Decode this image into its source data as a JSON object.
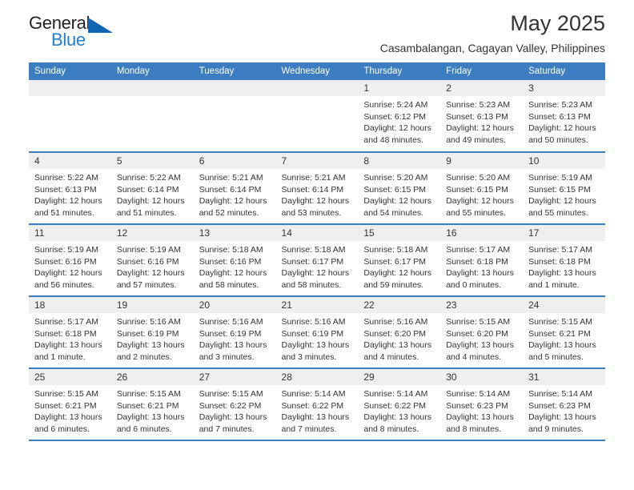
{
  "logo": {
    "word_top": "General",
    "word_bottom": "Blue",
    "triangle_icon": "triangle-icon",
    "color_black": "#231f20",
    "color_blue": "#1f7fd4"
  },
  "header": {
    "month_title": "May 2025",
    "location": "Casambalangan, Cagayan Valley, Philippines"
  },
  "theme": {
    "header_blue": "#3b7dc0",
    "daynum_gray": "#efefef",
    "text": "#333333"
  },
  "weekday_headers": [
    "Sunday",
    "Monday",
    "Tuesday",
    "Wednesday",
    "Thursday",
    "Friday",
    "Saturday"
  ],
  "weeks": [
    [
      {
        "day": "",
        "blank": true,
        "sunrise": "",
        "sunset": "",
        "daylight_line1": "",
        "daylight_line2": ""
      },
      {
        "day": "",
        "blank": true,
        "sunrise": "",
        "sunset": "",
        "daylight_line1": "",
        "daylight_line2": ""
      },
      {
        "day": "",
        "blank": true,
        "sunrise": "",
        "sunset": "",
        "daylight_line1": "",
        "daylight_line2": ""
      },
      {
        "day": "",
        "blank": true,
        "sunrise": "",
        "sunset": "",
        "daylight_line1": "",
        "daylight_line2": ""
      },
      {
        "day": "1",
        "blank": false,
        "sunrise": "Sunrise: 5:24 AM",
        "sunset": "Sunset: 6:12 PM",
        "daylight_line1": "Daylight: 12 hours",
        "daylight_line2": "and 48 minutes."
      },
      {
        "day": "2",
        "blank": false,
        "sunrise": "Sunrise: 5:23 AM",
        "sunset": "Sunset: 6:13 PM",
        "daylight_line1": "Daylight: 12 hours",
        "daylight_line2": "and 49 minutes."
      },
      {
        "day": "3",
        "blank": false,
        "sunrise": "Sunrise: 5:23 AM",
        "sunset": "Sunset: 6:13 PM",
        "daylight_line1": "Daylight: 12 hours",
        "daylight_line2": "and 50 minutes."
      }
    ],
    [
      {
        "day": "4",
        "blank": false,
        "sunrise": "Sunrise: 5:22 AM",
        "sunset": "Sunset: 6:13 PM",
        "daylight_line1": "Daylight: 12 hours",
        "daylight_line2": "and 51 minutes."
      },
      {
        "day": "5",
        "blank": false,
        "sunrise": "Sunrise: 5:22 AM",
        "sunset": "Sunset: 6:14 PM",
        "daylight_line1": "Daylight: 12 hours",
        "daylight_line2": "and 51 minutes."
      },
      {
        "day": "6",
        "blank": false,
        "sunrise": "Sunrise: 5:21 AM",
        "sunset": "Sunset: 6:14 PM",
        "daylight_line1": "Daylight: 12 hours",
        "daylight_line2": "and 52 minutes."
      },
      {
        "day": "7",
        "blank": false,
        "sunrise": "Sunrise: 5:21 AM",
        "sunset": "Sunset: 6:14 PM",
        "daylight_line1": "Daylight: 12 hours",
        "daylight_line2": "and 53 minutes."
      },
      {
        "day": "8",
        "blank": false,
        "sunrise": "Sunrise: 5:20 AM",
        "sunset": "Sunset: 6:15 PM",
        "daylight_line1": "Daylight: 12 hours",
        "daylight_line2": "and 54 minutes."
      },
      {
        "day": "9",
        "blank": false,
        "sunrise": "Sunrise: 5:20 AM",
        "sunset": "Sunset: 6:15 PM",
        "daylight_line1": "Daylight: 12 hours",
        "daylight_line2": "and 55 minutes."
      },
      {
        "day": "10",
        "blank": false,
        "sunrise": "Sunrise: 5:19 AM",
        "sunset": "Sunset: 6:15 PM",
        "daylight_line1": "Daylight: 12 hours",
        "daylight_line2": "and 55 minutes."
      }
    ],
    [
      {
        "day": "11",
        "blank": false,
        "sunrise": "Sunrise: 5:19 AM",
        "sunset": "Sunset: 6:16 PM",
        "daylight_line1": "Daylight: 12 hours",
        "daylight_line2": "and 56 minutes."
      },
      {
        "day": "12",
        "blank": false,
        "sunrise": "Sunrise: 5:19 AM",
        "sunset": "Sunset: 6:16 PM",
        "daylight_line1": "Daylight: 12 hours",
        "daylight_line2": "and 57 minutes."
      },
      {
        "day": "13",
        "blank": false,
        "sunrise": "Sunrise: 5:18 AM",
        "sunset": "Sunset: 6:16 PM",
        "daylight_line1": "Daylight: 12 hours",
        "daylight_line2": "and 58 minutes."
      },
      {
        "day": "14",
        "blank": false,
        "sunrise": "Sunrise: 5:18 AM",
        "sunset": "Sunset: 6:17 PM",
        "daylight_line1": "Daylight: 12 hours",
        "daylight_line2": "and 58 minutes."
      },
      {
        "day": "15",
        "blank": false,
        "sunrise": "Sunrise: 5:18 AM",
        "sunset": "Sunset: 6:17 PM",
        "daylight_line1": "Daylight: 12 hours",
        "daylight_line2": "and 59 minutes."
      },
      {
        "day": "16",
        "blank": false,
        "sunrise": "Sunrise: 5:17 AM",
        "sunset": "Sunset: 6:18 PM",
        "daylight_line1": "Daylight: 13 hours",
        "daylight_line2": "and 0 minutes."
      },
      {
        "day": "17",
        "blank": false,
        "sunrise": "Sunrise: 5:17 AM",
        "sunset": "Sunset: 6:18 PM",
        "daylight_line1": "Daylight: 13 hours",
        "daylight_line2": "and 1 minute."
      }
    ],
    [
      {
        "day": "18",
        "blank": false,
        "sunrise": "Sunrise: 5:17 AM",
        "sunset": "Sunset: 6:18 PM",
        "daylight_line1": "Daylight: 13 hours",
        "daylight_line2": "and 1 minute."
      },
      {
        "day": "19",
        "blank": false,
        "sunrise": "Sunrise: 5:16 AM",
        "sunset": "Sunset: 6:19 PM",
        "daylight_line1": "Daylight: 13 hours",
        "daylight_line2": "and 2 minutes."
      },
      {
        "day": "20",
        "blank": false,
        "sunrise": "Sunrise: 5:16 AM",
        "sunset": "Sunset: 6:19 PM",
        "daylight_line1": "Daylight: 13 hours",
        "daylight_line2": "and 3 minutes."
      },
      {
        "day": "21",
        "blank": false,
        "sunrise": "Sunrise: 5:16 AM",
        "sunset": "Sunset: 6:19 PM",
        "daylight_line1": "Daylight: 13 hours",
        "daylight_line2": "and 3 minutes."
      },
      {
        "day": "22",
        "blank": false,
        "sunrise": "Sunrise: 5:16 AM",
        "sunset": "Sunset: 6:20 PM",
        "daylight_line1": "Daylight: 13 hours",
        "daylight_line2": "and 4 minutes."
      },
      {
        "day": "23",
        "blank": false,
        "sunrise": "Sunrise: 5:15 AM",
        "sunset": "Sunset: 6:20 PM",
        "daylight_line1": "Daylight: 13 hours",
        "daylight_line2": "and 4 minutes."
      },
      {
        "day": "24",
        "blank": false,
        "sunrise": "Sunrise: 5:15 AM",
        "sunset": "Sunset: 6:21 PM",
        "daylight_line1": "Daylight: 13 hours",
        "daylight_line2": "and 5 minutes."
      }
    ],
    [
      {
        "day": "25",
        "blank": false,
        "sunrise": "Sunrise: 5:15 AM",
        "sunset": "Sunset: 6:21 PM",
        "daylight_line1": "Daylight: 13 hours",
        "daylight_line2": "and 6 minutes."
      },
      {
        "day": "26",
        "blank": false,
        "sunrise": "Sunrise: 5:15 AM",
        "sunset": "Sunset: 6:21 PM",
        "daylight_line1": "Daylight: 13 hours",
        "daylight_line2": "and 6 minutes."
      },
      {
        "day": "27",
        "blank": false,
        "sunrise": "Sunrise: 5:15 AM",
        "sunset": "Sunset: 6:22 PM",
        "daylight_line1": "Daylight: 13 hours",
        "daylight_line2": "and 7 minutes."
      },
      {
        "day": "28",
        "blank": false,
        "sunrise": "Sunrise: 5:14 AM",
        "sunset": "Sunset: 6:22 PM",
        "daylight_line1": "Daylight: 13 hours",
        "daylight_line2": "and 7 minutes."
      },
      {
        "day": "29",
        "blank": false,
        "sunrise": "Sunrise: 5:14 AM",
        "sunset": "Sunset: 6:22 PM",
        "daylight_line1": "Daylight: 13 hours",
        "daylight_line2": "and 8 minutes."
      },
      {
        "day": "30",
        "blank": false,
        "sunrise": "Sunrise: 5:14 AM",
        "sunset": "Sunset: 6:23 PM",
        "daylight_line1": "Daylight: 13 hours",
        "daylight_line2": "and 8 minutes."
      },
      {
        "day": "31",
        "blank": false,
        "sunrise": "Sunrise: 5:14 AM",
        "sunset": "Sunset: 6:23 PM",
        "daylight_line1": "Daylight: 13 hours",
        "daylight_line2": "and 9 minutes."
      }
    ]
  ]
}
